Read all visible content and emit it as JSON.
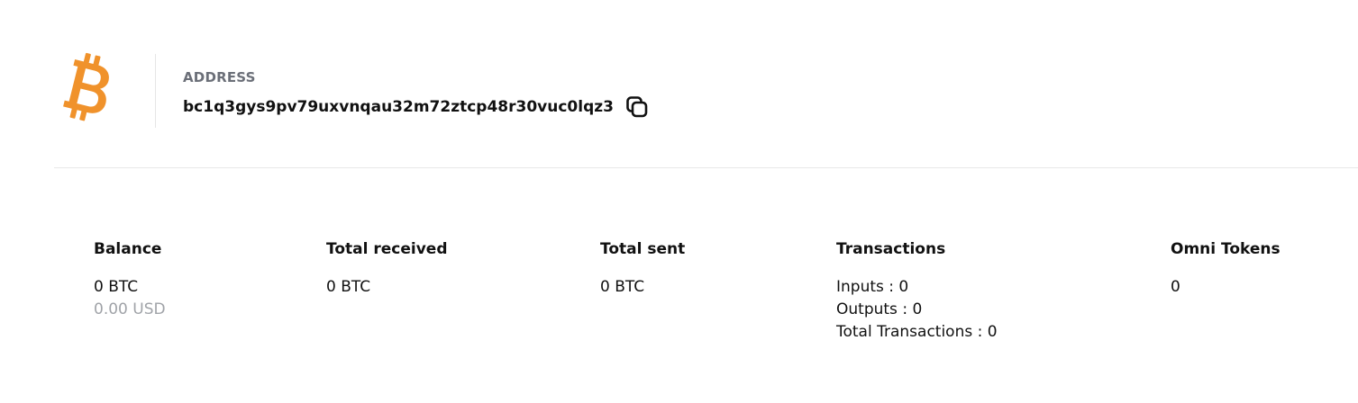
{
  "header": {
    "coin_icon": "bitcoin-icon",
    "coin_color": "#F0922B",
    "address_label": "ADDRESS",
    "address_value": "bc1q3gys9pv79uxvnqau32m72ztcp48r30vuc0lqz3",
    "copy_icon": "copy-icon"
  },
  "stats": {
    "balance": {
      "title": "Balance",
      "btc": "0 BTC",
      "usd": "0.00 USD"
    },
    "total_received": {
      "title": "Total received",
      "btc": "0 BTC"
    },
    "total_sent": {
      "title": "Total sent",
      "btc": "0 BTC"
    },
    "transactions": {
      "title": "Transactions",
      "inputs": "Inputs : 0",
      "outputs": "Outputs : 0",
      "total": "Total Transactions : 0"
    },
    "omni_tokens": {
      "title": "Omni Tokens",
      "value": "0"
    }
  }
}
